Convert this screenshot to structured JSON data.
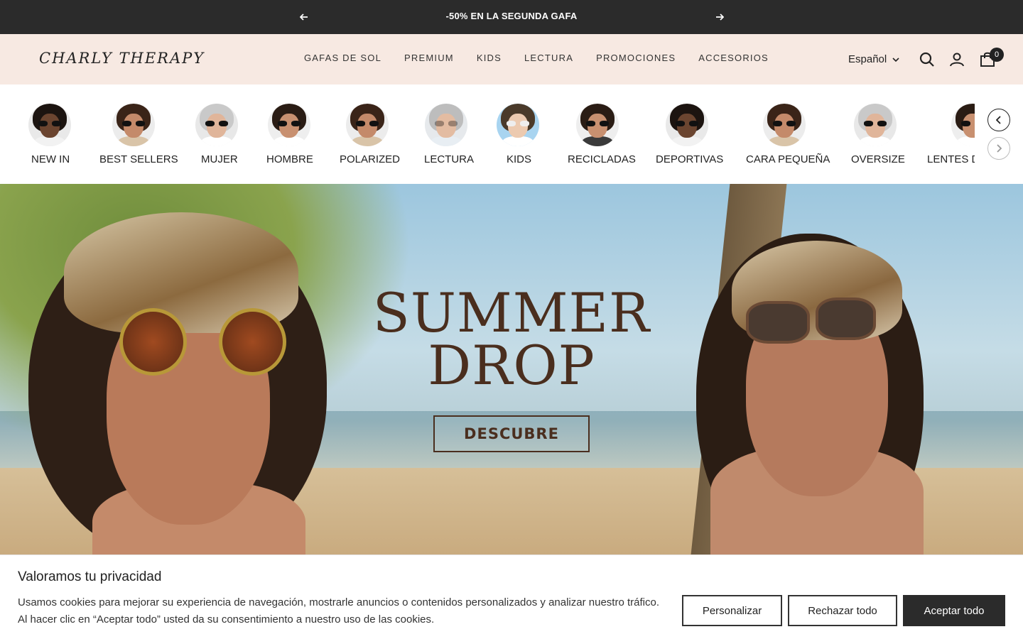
{
  "announcement": {
    "message": "-50% EN LA SEGUNDA GAFA"
  },
  "header": {
    "logo": "CHARLY THERAPY",
    "nav": [
      "GAFAS DE SOL",
      "PREMIUM",
      "KIDS",
      "LECTURA",
      "PROMOCIONES",
      "ACCESORIOS"
    ],
    "language": "Español",
    "cart_count": "0"
  },
  "categories": [
    {
      "label": "NEW IN",
      "skin": "#6b4530",
      "hair": "#1c1410",
      "shirt": "#f2f2f2"
    },
    {
      "label": "BEST SELLERS",
      "skin": "#c48a6a",
      "hair": "#3a2418",
      "shirt": "#d9c4a8"
    },
    {
      "label": "MUJER",
      "skin": "#e0b59a",
      "hair": "#c9c9c9",
      "shirt": "#ffffff"
    },
    {
      "label": "HOMBRE",
      "skin": "#c89070",
      "hair": "#2a1c14",
      "shirt": "#ffffff"
    },
    {
      "label": "POLARIZED",
      "skin": "#c48a6a",
      "hair": "#3a2418",
      "shirt": "#d9c4a8"
    },
    {
      "label": "LECTURA",
      "skin": "#e3bca2",
      "hair": "#bdbdbd",
      "shirt": "#e8eef3"
    },
    {
      "label": "KIDS",
      "skin": "#eccab0",
      "hair": "#4a3a2a",
      "shirt": "#ffffff"
    },
    {
      "label": "RECICLADAS",
      "skin": "#c89070",
      "hair": "#2a1c14",
      "shirt": "#3a3a3a"
    },
    {
      "label": "DEPORTIVAS",
      "skin": "#6b4530",
      "hair": "#1c1410",
      "shirt": "#f2f2f2"
    },
    {
      "label": "CARA PEQUEÑA",
      "skin": "#c48a6a",
      "hair": "#3a2418",
      "shirt": "#d9c4a8"
    },
    {
      "label": "OVERSIZE",
      "skin": "#e0b59a",
      "hair": "#c9c9c9",
      "shirt": "#ffffff"
    },
    {
      "label": "LENTES D",
      "skin": "#c89070",
      "hair": "#2a1c14",
      "shirt": "#ffffff"
    }
  ],
  "hero": {
    "title_line1": "SUMMER",
    "title_line2": "DROP",
    "button": "DESCUBRE"
  },
  "cookie": {
    "title": "Valoramos tu privacidad",
    "text_line1": "Usamos cookies para mejorar su experiencia de navegación, mostrarle anuncios o contenidos personalizados y analizar nuestro tráfico.",
    "text_line2": "Al hacer clic en “Aceptar todo” usted da su consentimiento a nuestro uso de las cookies.",
    "customize": "Personalizar",
    "reject": "Rechazar todo",
    "accept": "Aceptar todo"
  }
}
